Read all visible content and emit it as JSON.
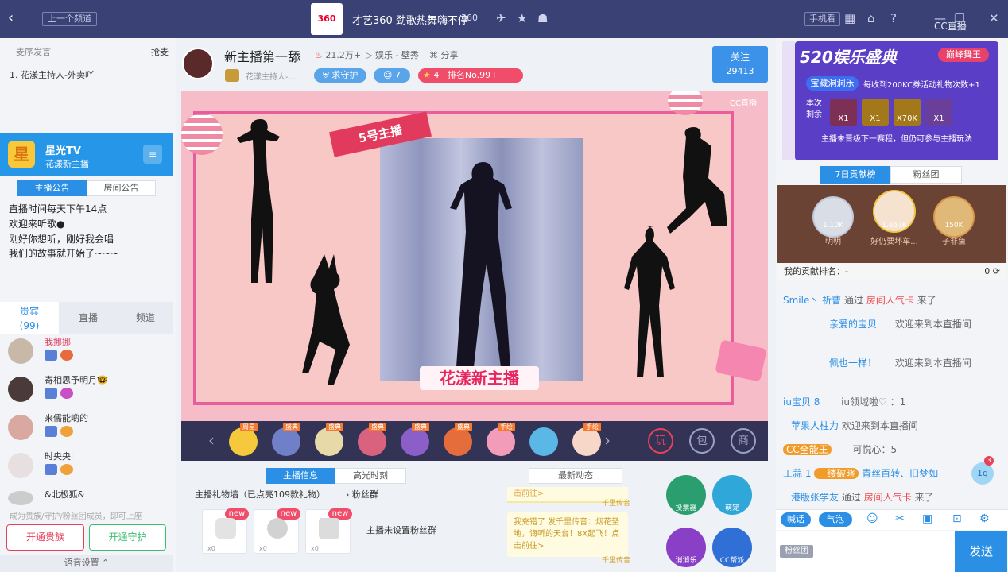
{
  "topbar": {
    "prev_channel": "上一个频道",
    "channel_logo": "360",
    "channel_title": "才艺360 劲歌热舞嗨不停",
    "channel_number": "360",
    "phone_view": "手机看",
    "brand": "CC直播"
  },
  "left": {
    "seq_mic": "麦序发言",
    "grab_mic": "抢麦",
    "mic_item": "1. 花漾主持人-外卖吖",
    "star_title": "星光TV",
    "star_sub": "花漾新主播",
    "tab_anchor_notice": "主播公告",
    "tab_room_notice": "房间公告",
    "notice_lines": [
      "直播时间每天下午14点",
      "欢迎来听歌●",
      "刚好你想听，刚好我会唱",
      "我们的故事就开始了~~~"
    ],
    "tabs": [
      "贵宾",
      "直播",
      "频道"
    ],
    "vip_count": "(99)",
    "users": [
      "我挪挪",
      "寄相思予明月🤓",
      "来儒能啲的",
      "时央央i",
      "&北极狐&"
    ],
    "hint": "成为贵族/守护/粉丝团成员，即可上座",
    "btn_guizu": "开通贵族",
    "btn_shouhu": "开通守护",
    "voice_settings": "语音设置"
  },
  "anchor": {
    "name": "新主播第一舔",
    "heat": "21.2万+",
    "category": "娱乐 - 壁秀",
    "share": "分享",
    "subtitle": "花漾主持人-...",
    "guard": "求守护",
    "fans": "7",
    "star_count": "4",
    "rank": "排名No.99+",
    "follow": "关注",
    "follow_count": "29413"
  },
  "stage": {
    "tag": "5号主播",
    "brand": "花漾新主播",
    "cc": "CC直播"
  },
  "gifts": [
    {
      "badge": "周星",
      "color": "#f5c93b"
    },
    {
      "badge": "盛典",
      "color": "#6f7fc8"
    },
    {
      "badge": "盛典",
      "color": "#e8d9a8"
    },
    {
      "badge": "盛典",
      "color": "#d9637f"
    },
    {
      "badge": "盛典",
      "color": "#8b5fc7"
    },
    {
      "badge": "盛典",
      "color": "#e56d3c"
    },
    {
      "badge": "手绘",
      "color": "#f39cb9"
    },
    {
      "badge": "",
      "color": "#5ab7e6"
    },
    {
      "badge": "手绘",
      "color": "#f7d8c8"
    }
  ],
  "giftbar_right": [
    "玩",
    "包",
    "商"
  ],
  "info": {
    "tab_info": "主播信息",
    "tab_highlight": "高光时刻",
    "tab_news": "最新动态",
    "gift_wall": "主播礼物墙（已点亮109款礼物）",
    "fan_group": "粉丝群",
    "no_fan_group": "主播未设置粉丝群",
    "new_label": "new",
    "zero": "x0",
    "news_top": "击前往>",
    "news_top_brand": "千里传音",
    "news_text": "我充错了 发千里传音：烟花圣地，诲听的天台！8X起飞！点击前往>",
    "news_bottom_brand": "千里传音",
    "apps": [
      "投票器",
      "萌宠",
      "消消乐",
      "CC帮派"
    ]
  },
  "event": {
    "title": "520娱乐盛典",
    "tag": "巅峰舞王",
    "sub_pill": "宝藏洞洞乐",
    "sub_text": "每收到200KC券活动礼物次数+1",
    "remain": "本次剩余",
    "counts": [
      "X1",
      "X1",
      "X70K",
      "X1"
    ],
    "footer": "主播未晋级下一赛程，但仍可参与主播玩法"
  },
  "rank": {
    "tab_week": "7日贡献榜",
    "tab_fans": "粉丝团",
    "top3": [
      {
        "name": "明明",
        "score": "1.10K"
      },
      {
        "name": "好仍要坏车...",
        "score": "1.657K"
      },
      {
        "name": "子非鱼",
        "score": "150K"
      }
    ],
    "my_rank": "我的贡献排名：-",
    "my_value": "0"
  },
  "chat": [
    {
      "nick": "Smile丶 祈曹",
      "text": "通过",
      "extra": "房间人气卡",
      "tail": "来了"
    },
    {
      "nick": "亲爱的宝贝",
      "text": "欢迎来到本直播间",
      "extra": "",
      "tail": ""
    },
    {
      "nick": "佩也一样！",
      "text": "欢迎来到本直播间",
      "extra": "",
      "tail": ""
    },
    {
      "nick": "iu宝贝 8",
      "text": "iu领域啦♡ ：1",
      "extra": "",
      "tail": ""
    },
    {
      "nick": "苹果人柱力",
      "text": "欢迎来到本直播间",
      "extra": "",
      "tail": ""
    },
    {
      "nick": "CC全能王",
      "text": "可悦心：5",
      "extra": "",
      "tail": ""
    },
    {
      "nick": "工蒜 1",
      "text": "一缕破晓",
      "extra": "青丝百转、旧梦如",
      "tail": ""
    },
    {
      "nick": "港版张学友",
      "text": "通过",
      "extra": "房间人气卡",
      "tail": "来了"
    }
  ],
  "chat_tools": [
    "喊话",
    "气泡"
  ],
  "fan_badge": "粉丝团",
  "send": "发送",
  "float_badge": "3",
  "float_level": "1g"
}
